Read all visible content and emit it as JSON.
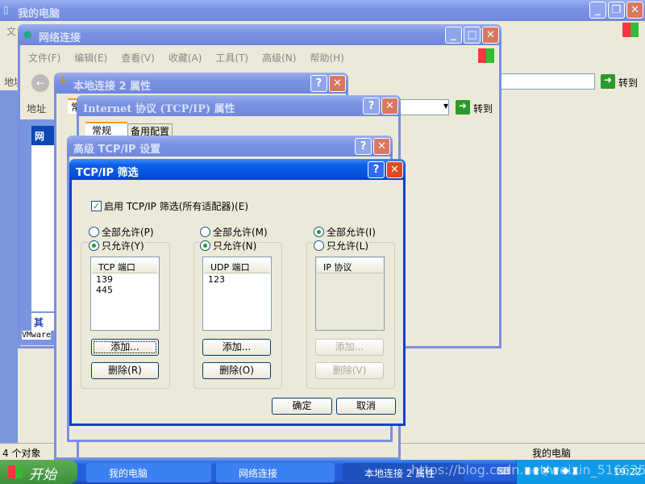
{
  "my_computer": {
    "title": "我的电脑",
    "menu_first": "文",
    "address": "地址",
    "status": "4 个对象",
    "status_right": "我的电脑",
    "go": "转到"
  },
  "network": {
    "title": "网络连接",
    "menu": [
      "文件(F)",
      "编辑(E)",
      "查看(V)",
      "收藏(A)",
      "工具(T)",
      "高级(N)",
      "帮助(H)"
    ],
    "address": "地址",
    "go": "转到",
    "side_header": "网",
    "side_other": "其",
    "vmware": "VMware"
  },
  "local_props": {
    "title": "本地连接 2 属性",
    "tab": "常"
  },
  "tcpip_props": {
    "title": "Internet 协议 (TCP/IP) 属性",
    "tabs": [
      "常规",
      "备用配置"
    ]
  },
  "advanced": {
    "title": "高级 TCP/IP 设置"
  },
  "filter": {
    "title": "TCP/IP 筛选",
    "enable_label": "启用 TCP/IP 筛选(所有适配器)(E)",
    "enable_checked": true,
    "columns": [
      {
        "all": "全部允许(P)",
        "only": "只允许(Y)",
        "selected": "only",
        "header": "TCP 端口",
        "items": [
          "139",
          "445"
        ],
        "add": "添加...",
        "remove": "删除(R)",
        "enabled": true
      },
      {
        "all": "全部允许(M)",
        "only": "只允许(N)",
        "selected": "only",
        "header": "UDP 端口",
        "items": [
          "123"
        ],
        "add": "添加...",
        "remove": "删除(O)",
        "enabled": true
      },
      {
        "all": "全部允许(I)",
        "only": "只允许(L)",
        "selected": "all",
        "header": "IP 协议",
        "items": [],
        "add": "添加...",
        "remove": "删除(V)",
        "enabled": false
      }
    ],
    "ok": "确定",
    "cancel": "取消"
  },
  "taskbar": {
    "start": "开始",
    "tasks": [
      "我的电脑",
      "网络连接",
      "本地连接 2 属性"
    ],
    "clock": "19:22",
    "watermark": "https://blog.csdn.net/weixin_51663573"
  }
}
